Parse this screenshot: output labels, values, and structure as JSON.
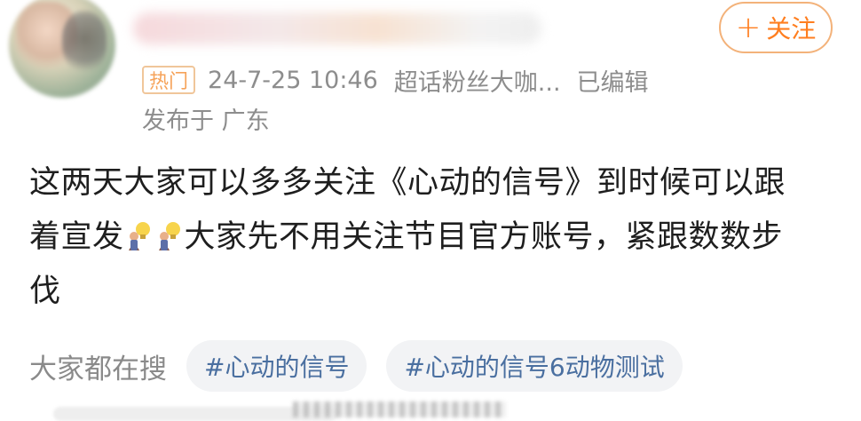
{
  "post": {
    "follow_label": "关注",
    "hot_badge": "热门",
    "timestamp": "24-7-25 10:46",
    "source": "超话粉丝大咖...",
    "edited": "已编辑",
    "location": "发布于 广东",
    "content_line1": "这两天大家可以多多关注《心动的信号》到时候可以跟",
    "content_line2_a": "着宣发",
    "content_line2_b": "大家先不用关注节目官方账号，紧跟数数步",
    "content_line3": "伐"
  },
  "search": {
    "label": "大家都在搜",
    "topics": [
      "#心动的信号",
      "#心动的信号6动物测试"
    ]
  },
  "colors": {
    "accent": "#ff7e1f",
    "topic_text": "#4a6fa0",
    "meta_text": "#8d8d8d"
  },
  "icons": {
    "content_emoji": "lightbulb-person-emoji"
  }
}
